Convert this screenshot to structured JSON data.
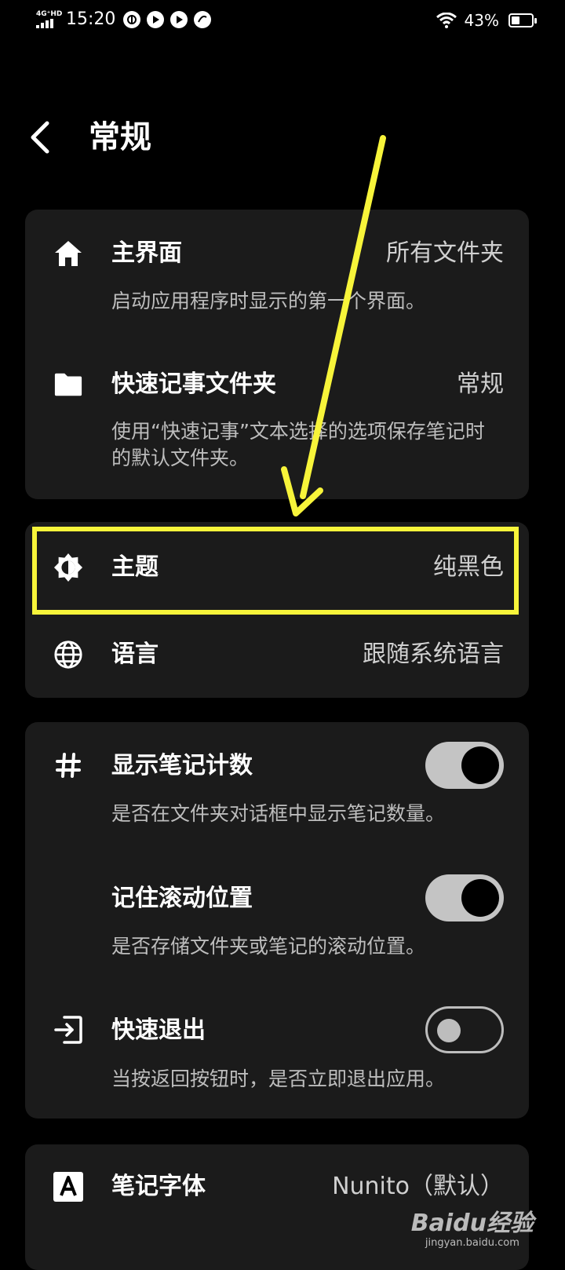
{
  "status_bar": {
    "network": "4G⁺HD",
    "time": "15:20",
    "battery": "43%"
  },
  "header": {
    "title": "常规"
  },
  "sections": {
    "home": {
      "title": "主界面",
      "value": "所有文件夹",
      "description": "启动应用程序时显示的第一个界面。"
    },
    "quick_note_folder": {
      "title": "快速记事文件夹",
      "value": "常规",
      "description": "使用“快速记事”文本选择的选项保存笔记时的默认文件夹。"
    },
    "theme": {
      "title": "主题",
      "value": "纯黑色"
    },
    "language": {
      "title": "语言",
      "value": "跟随系统语言"
    },
    "show_note_count": {
      "title": "显示笔记计数",
      "description": "是否在文件夹对话框中显示笔记数量。",
      "enabled": true
    },
    "remember_scroll": {
      "title": "记住滚动位置",
      "description": "是否存储文件夹或笔记的滚动位置。",
      "enabled": true
    },
    "quick_exit": {
      "title": "快速退出",
      "description": "当按返回按钮时，是否立即退出应用。",
      "enabled": false
    },
    "note_font": {
      "title": "笔记字体",
      "value": "Nunito（默认）"
    }
  },
  "watermark": {
    "logo": "Baidu经验",
    "url": "jingyan.baidu.com"
  },
  "colors": {
    "background": "#000000",
    "card": "#1b1b1b",
    "annotation": "#f7f43a"
  }
}
